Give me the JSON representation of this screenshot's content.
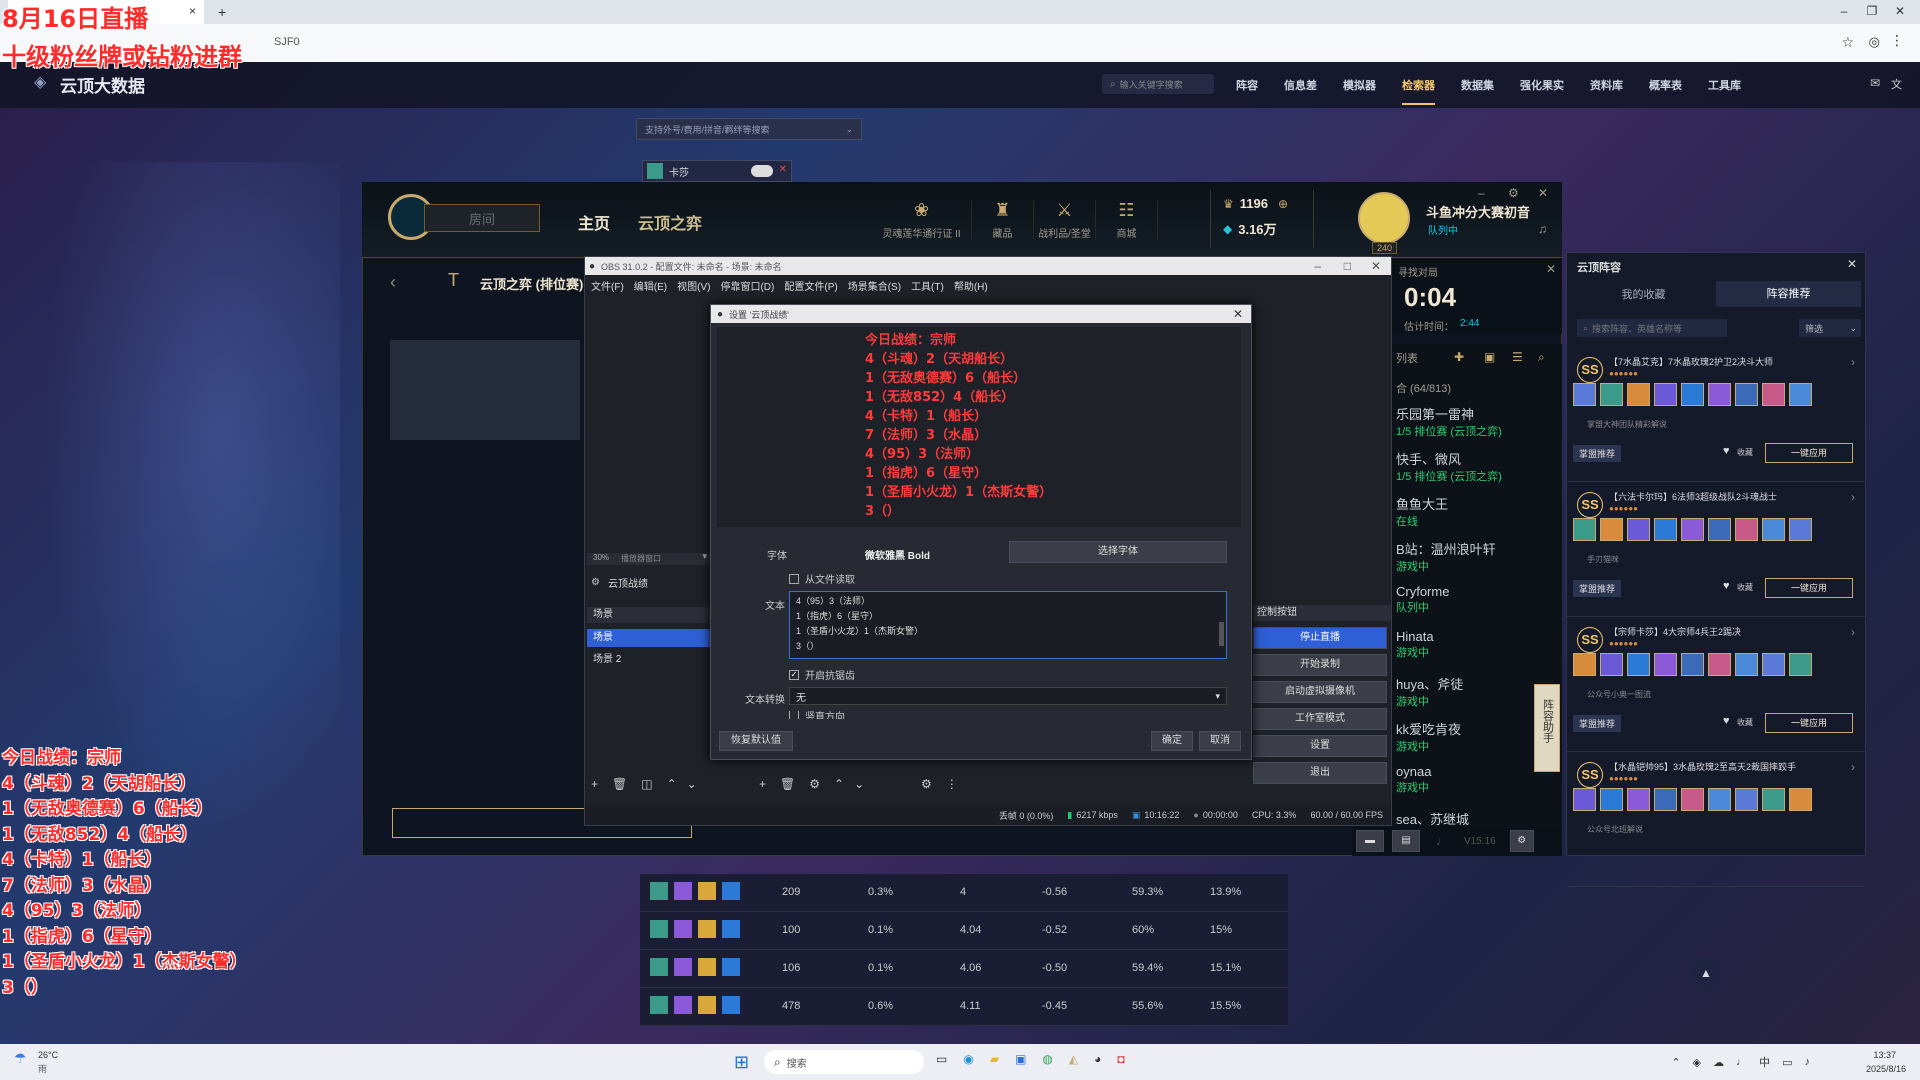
{
  "overlay": {
    "stream_title": "8月16日直播",
    "stream_sub": "十级粉丝牌或钻粉进群",
    "record_lines": [
      "今日战绩：宗师",
      "4（斗魂）2（天胡船长）",
      "1（无敌奥德赛）6（船长）",
      "1（无敌852）4（船长）",
      "4（卡特）1（船长）",
      "7（法师）3（水晶）",
      "4（95）3（法师）",
      "1（指虎）6（星守）",
      "1（圣盾小火龙）1（杰斯女警）",
      "3（）"
    ]
  },
  "browser": {
    "tab_close": "×",
    "new_tab": "+",
    "url_fragment": "SJF0"
  },
  "site": {
    "logo": "云顶大数据",
    "search_placeholder": "输入关键字搜索",
    "nav": [
      "阵容",
      "信息差",
      "模拟器",
      "检索器",
      "数据集",
      "强化果实",
      "资料库",
      "概率表",
      "工具库"
    ],
    "active_nav": "检索器",
    "filter_placeholder": "支持外号/费用/拼音/羁绊等搜索",
    "chip_label": "卡莎"
  },
  "lol": {
    "room": "房间",
    "home": "主页",
    "tft": "云顶之弈",
    "icons": [
      "灵魂莲华通行证 II",
      "藏品",
      "战利品/圣堂",
      "商城"
    ],
    "currency1": "1196",
    "currency2": "3.16万",
    "username": "斗鱼冲分大赛初音",
    "status": "队列中",
    "level": "240",
    "queue_title": "云顶之弈 (排位赛)",
    "find_match": "寻找对局",
    "timer": "0:04",
    "est_label": "估计时间：",
    "est_time": "2:44",
    "friends_header": "列表",
    "friends_count": "合 (64/813)",
    "version": "V15.16",
    "friends": [
      {
        "name": "乐园第一雷神",
        "status": "1/5 排位赛 (云顶之弈)"
      },
      {
        "name": "快手、微风",
        "status": "1/5 排位赛 (云顶之弈)"
      },
      {
        "name": "鱼鱼大王",
        "status": "在线"
      },
      {
        "name": "B站：温州浪叶轩",
        "status": "游戏中"
      },
      {
        "name": "Cryforme",
        "status": "队列中"
      },
      {
        "name": "Hinata",
        "status": "游戏中"
      },
      {
        "name": "huya、斧徒",
        "status": "游戏中"
      },
      {
        "name": "kk爱吃肯夜",
        "status": "游戏中"
      },
      {
        "name": "oynaa",
        "status": "游戏中"
      },
      {
        "name": "sea、苏继城",
        "status": ""
      }
    ]
  },
  "obs": {
    "title": "OBS 31.0.2 - 配置文件: 未命名 - 场景: 未命名",
    "menu": [
      "文件(F)",
      "编辑(E)",
      "视图(V)",
      "停靠窗口(D)",
      "配置文件(P)",
      "场景集合(S)",
      "工具(T)",
      "帮助(H)"
    ],
    "zoom": "30%",
    "zoom_label": "播放器窗口",
    "source_name": "云顶战绩",
    "scenes_header": "场景",
    "scenes": [
      "场景",
      "场景 2"
    ],
    "controls_header": "控制按钮",
    "controls": [
      "停止直播",
      "开始录制",
      "启动虚拟摄像机",
      "工作室模式",
      "设置",
      "退出"
    ],
    "status": {
      "dropped": "丢帧 0 (0.0%)",
      "kbps": "6217 kbps",
      "live_time": "10:16:22",
      "rec_time": "00:00:00",
      "cpu": "CPU: 3.3%",
      "fps": "60.00 / 60.00 FPS"
    }
  },
  "dialog": {
    "title": "设置 '云顶战绩'",
    "font_label": "字体",
    "font_value": "微软雅黑 Bold",
    "choose_font": "选择字体",
    "from_file": "从文件读取",
    "text_label": "文本",
    "text_lines": [
      "4（95）3（法师）",
      "1（指虎）6（星守）",
      "1（圣盾小火龙）1（杰斯女警）",
      "3（）"
    ],
    "antialias": "开启抗锯齿",
    "transform_label": "文本转换",
    "transform_value": "无",
    "vertical": "竖直方向",
    "defaults": "恢复默认值",
    "ok": "确定",
    "cancel": "取消"
  },
  "side": {
    "title": "云顶阵容",
    "tabs": [
      "我的收藏",
      "阵容推荐"
    ],
    "search_placeholder": "搜索阵容、英雄名称等",
    "filter": "筛选",
    "assist_label": "阵容助手",
    "cards": [
      {
        "grade": "SS",
        "title": "【7水晶艾克】7水晶玫瑰2护卫2决斗大师",
        "author": "掌盟大神团队精彩解说",
        "tag": "掌盟推荐",
        "fav": "收藏",
        "apply": "一键应用"
      },
      {
        "grade": "SS",
        "title": "【六法卡尔玛】6法师3超级战队2斗魂战士",
        "author": "手刃猫咪",
        "tag": "掌盟推荐",
        "fav": "收藏",
        "apply": "一键应用"
      },
      {
        "grade": "SS",
        "title": "【宗师卡莎】4大宗师4兵王2踢决",
        "author": "公众号小奥一图流",
        "tag": "掌盟推荐",
        "fav": "收藏",
        "apply": "一键应用"
      },
      {
        "grade": "SS",
        "title": "【水晶铠帅95】3水晶玫瑰2至高天2裁国摔跤手",
        "author": "公众号北班解说",
        "tag": "",
        "fav": "",
        "apply": ""
      }
    ]
  },
  "table": {
    "rows": [
      [
        "209",
        "0.3%",
        "4",
        "-0.56",
        "59.3%",
        "13.9%"
      ],
      [
        "100",
        "0.1%",
        "4.04",
        "-0.52",
        "60%",
        "15%"
      ],
      [
        "106",
        "0.1%",
        "4.06",
        "-0.50",
        "59.4%",
        "15.1%"
      ],
      [
        "478",
        "0.6%",
        "4.11",
        "-0.45",
        "55.6%",
        "15.5%"
      ]
    ]
  },
  "taskbar": {
    "weather_temp": "26°C",
    "weather_desc": "雨",
    "search": "搜索",
    "ime": "中",
    "time": "13:37",
    "date": "2025/8/16"
  }
}
